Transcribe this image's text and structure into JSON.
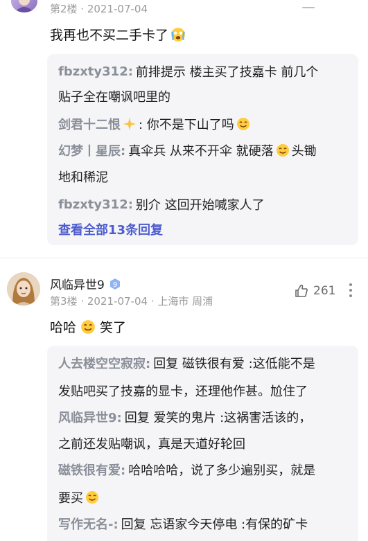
{
  "floor2": {
    "meta": "第2楼 · 2021-07-04",
    "text": "我再也不买二手卡了",
    "replies": [
      {
        "user": "fbzxty312:",
        "text": "前排提示 楼主买了技嘉卡 前几个"
      },
      {
        "user": "",
        "text": "贴子全在嘲讽吧里的"
      },
      {
        "user": "剑君十二恨",
        "text": ": 你不是下山了吗"
      },
      {
        "user": "幻梦丨星辰:",
        "text": "真伞兵 从来不开伞 就硬落",
        "tail": "头锄"
      },
      {
        "user": "",
        "text": "地和稀泥"
      },
      {
        "user": "fbzxty312:",
        "text": "别介 这回开始喊家人了"
      }
    ],
    "view_all": "查看全部13条回复"
  },
  "floor3": {
    "username": "风临异世9",
    "level": "9",
    "meta_floor": "第3楼",
    "meta_date": "2021-07-04",
    "meta_location": "上海市 周浦",
    "likes": "261",
    "text_a": "哈哈",
    "text_b": "笑了",
    "replies": [
      {
        "user": "人去楼空空寂寂:",
        "text": "回复 磁铁很有爱 :这低能不是"
      },
      {
        "user": "",
        "text": "发贴吧买了技嘉的显卡，还理他作甚。尬住了"
      },
      {
        "user": "风临异世9:",
        "text": "回复 爱笑的鬼片 :这祸害活该的，"
      },
      {
        "user": "",
        "text": "之前还发贴嘲讽，真是天道好轮回"
      },
      {
        "user": "磁铁很有爱:",
        "text": "哈哈哈哈，说了多少遍别买，就是"
      },
      {
        "user": "",
        "text": "要买"
      },
      {
        "user": "写作无名-:",
        "text": "回复 忘语家今天停电 :有保的矿卡"
      }
    ]
  },
  "colors": {
    "username_gray": "#8a8f99",
    "link_blue": "#4c5ccf",
    "reply_bg": "#f5f5f7"
  }
}
